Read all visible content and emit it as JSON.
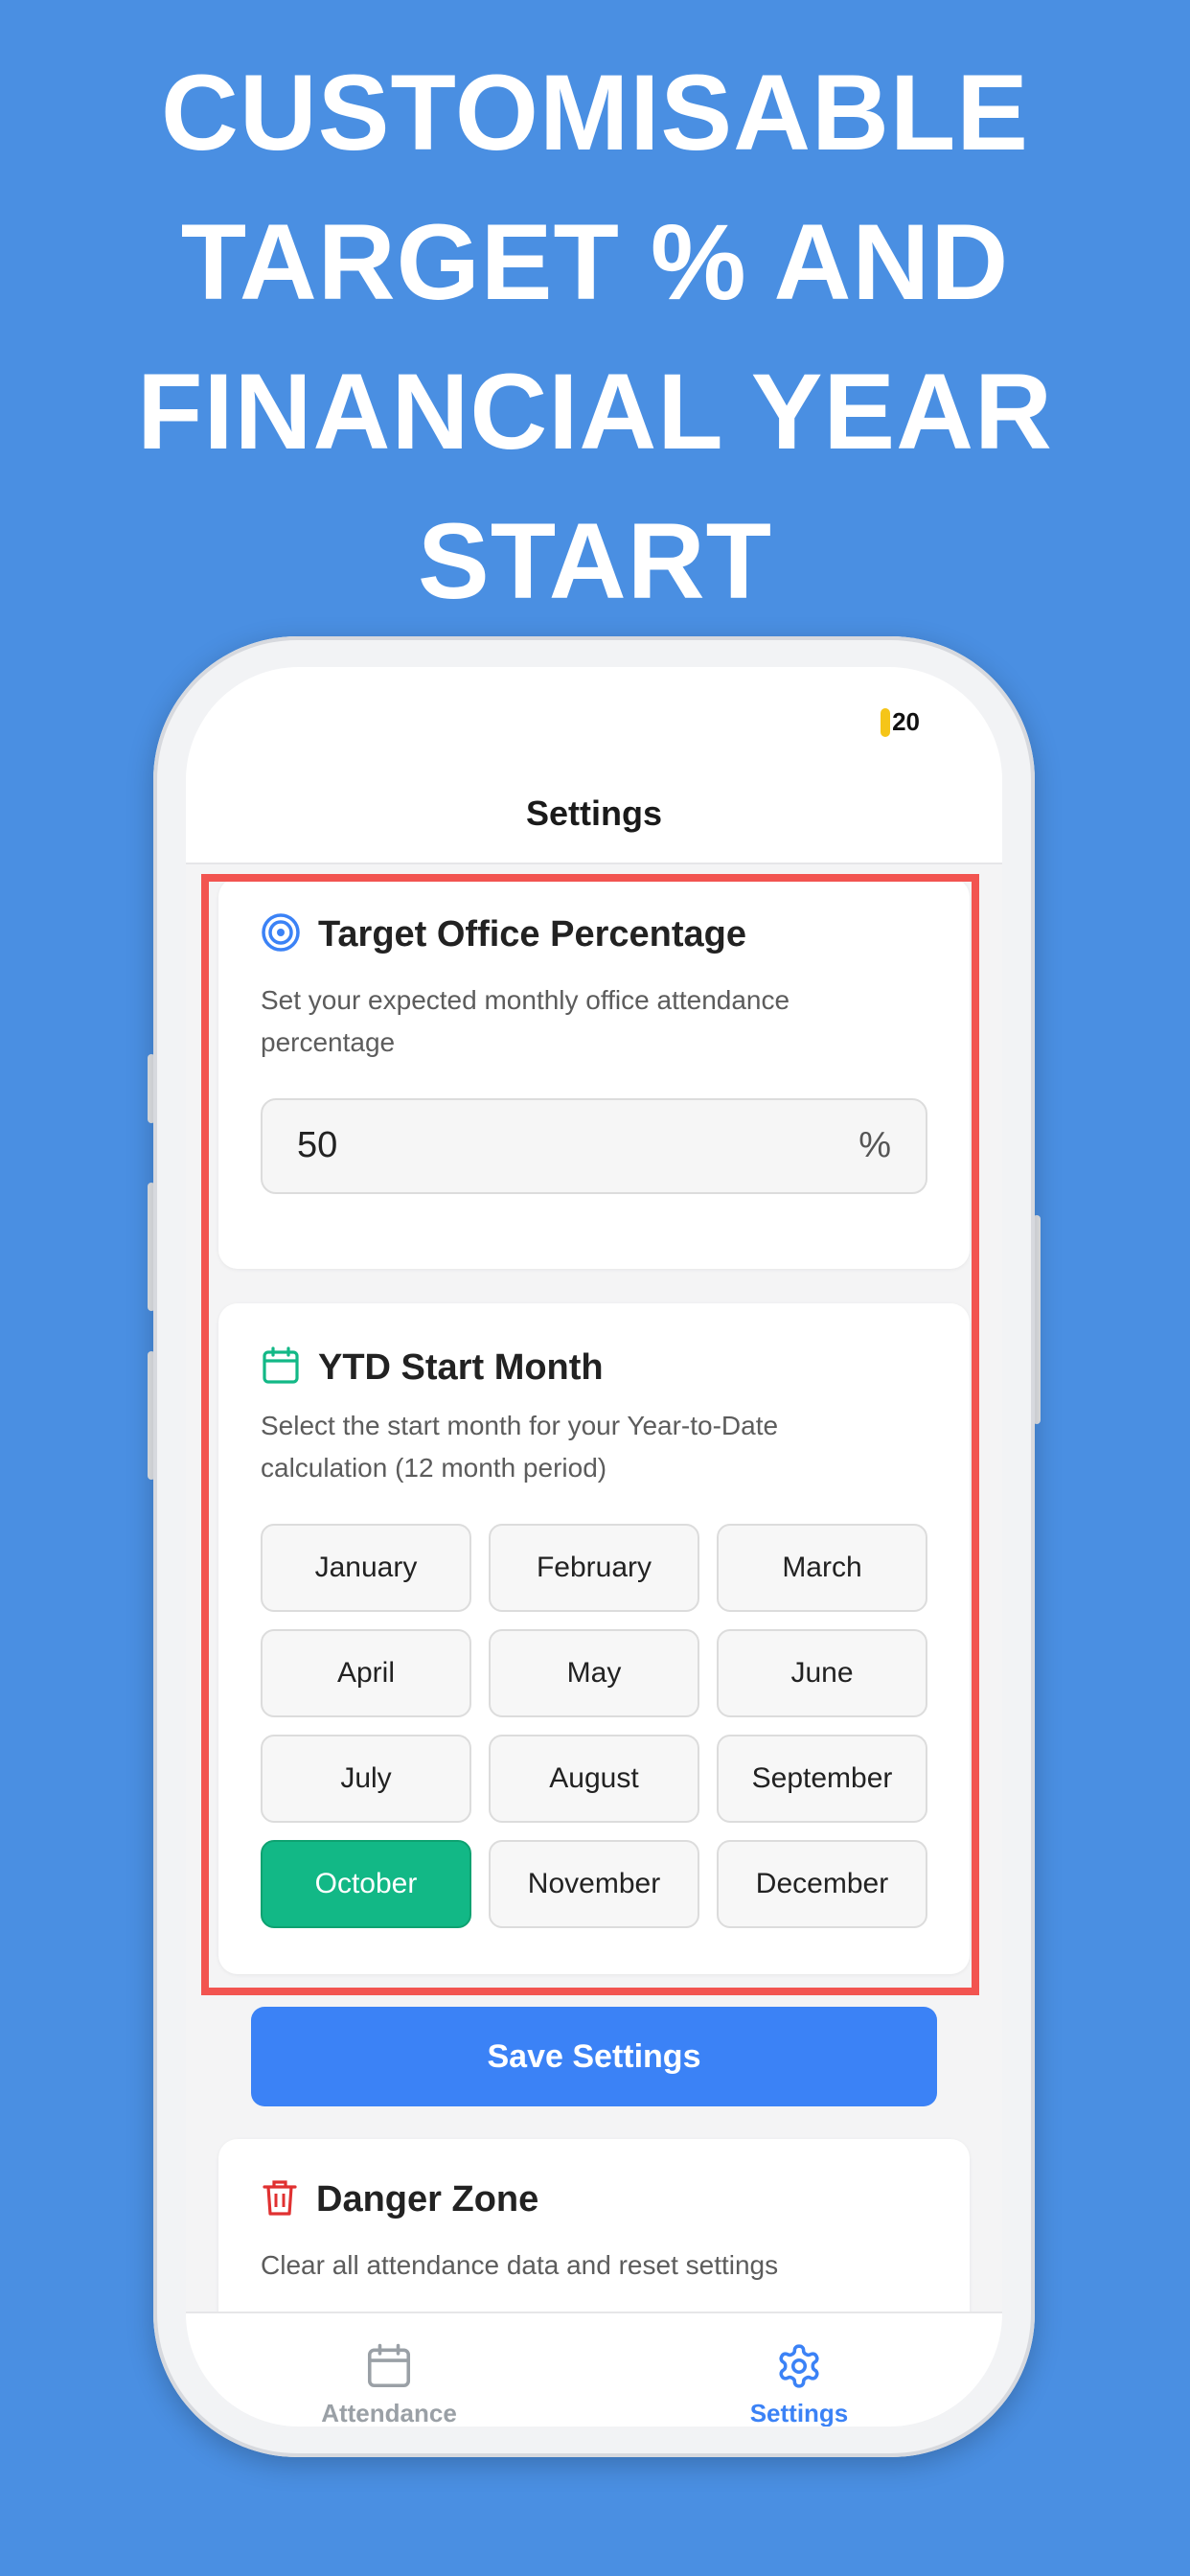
{
  "headline": {
    "line1": "CUSTOMISABLE",
    "line2": "TARGET % AND",
    "line3": "FINANCIAL YEAR",
    "line4": "START"
  },
  "status_bar": {
    "time": "20",
    "indicator_color": "#f5c518"
  },
  "header": {
    "title": "Settings"
  },
  "target_card": {
    "icon": "target-icon",
    "title": "Target Office Percentage",
    "description": "Set your expected monthly office attendance percentage",
    "input_value": "50",
    "unit": "%"
  },
  "ytd_card": {
    "icon": "calendar-icon",
    "title": "YTD Start Month",
    "description": "Select the start month for your Year-to-Date calculation (12 month period)",
    "months": [
      "January",
      "February",
      "March",
      "April",
      "May",
      "June",
      "July",
      "August",
      "September",
      "October",
      "November",
      "December"
    ],
    "selected": "October"
  },
  "save_button": {
    "label": "Save Settings"
  },
  "danger_card": {
    "icon": "trash-icon",
    "title": "Danger Zone",
    "description": "Clear all attendance data and reset settings"
  },
  "tabs": [
    {
      "label": "Attendance",
      "icon": "calendar-icon",
      "active": false
    },
    {
      "label": "Settings",
      "icon": "gear-icon",
      "active": true
    }
  ],
  "colors": {
    "background": "#4a8fe2",
    "accent_blue": "#3b82f6",
    "selected_green": "#12b886",
    "highlight_red": "#f25450",
    "danger_red": "#e03131",
    "inactive_tab": "#9aa0a6"
  }
}
